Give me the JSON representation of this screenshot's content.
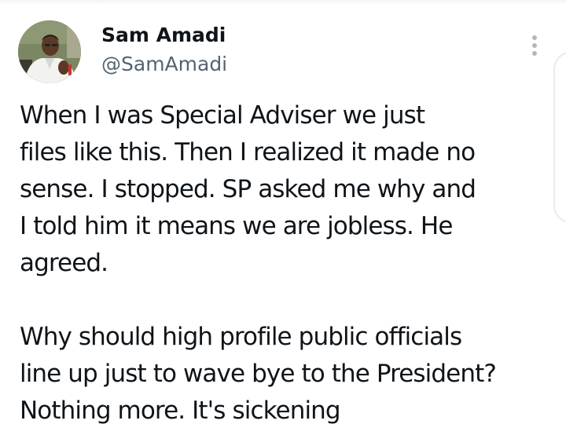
{
  "author": {
    "name": "Sam Amadi",
    "handle": "@SamAmadi"
  },
  "icons": {
    "avatar": "profile-photo",
    "more": "vertical-ellipsis-icon"
  },
  "tweet": {
    "paragraph1": [
      "When I was Special Adviser we just",
      "files like this. Then I realized it made no",
      "sense. I stopped. SP asked me why and",
      "I told him it means we are jobless. He",
      "agreed."
    ],
    "paragraph2": [
      "Why should high profile public officials",
      "line up just to wave bye to the President?",
      "Nothing more. It's sickening"
    ]
  },
  "colors": {
    "text": "#0f1419",
    "secondary": "#536471",
    "background": "#ffffff"
  }
}
